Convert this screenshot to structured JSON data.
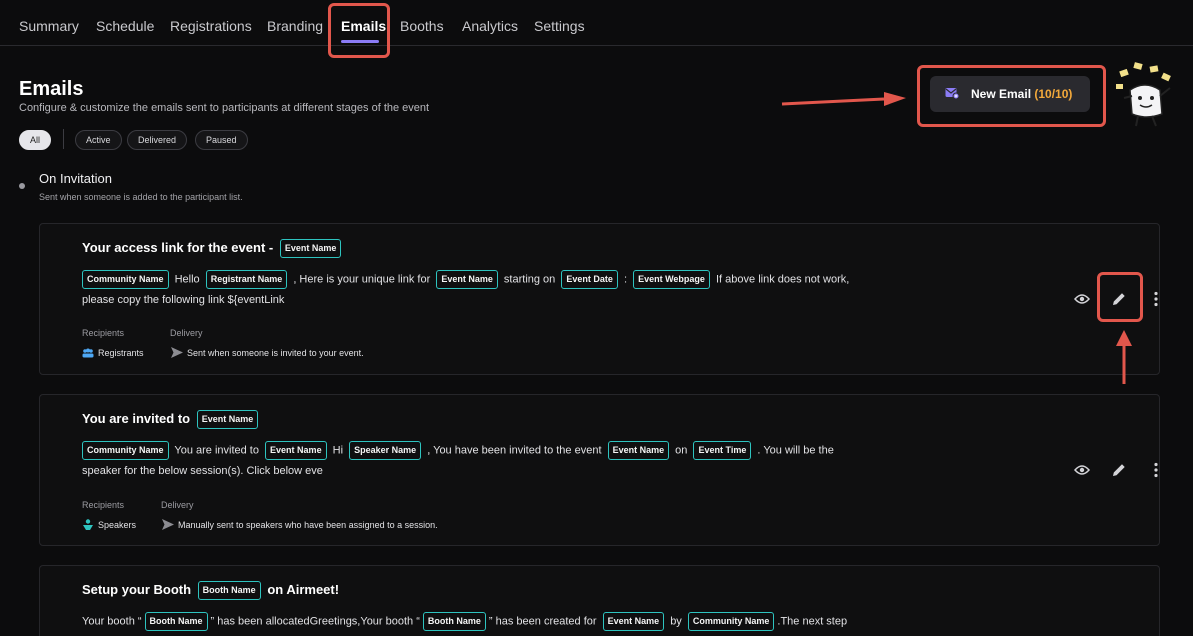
{
  "nav": {
    "tabs": [
      "Summary",
      "Schedule",
      "Registrations",
      "Branding",
      "Emails",
      "Booths",
      "Analytics",
      "Settings"
    ],
    "active": "Emails"
  },
  "header": {
    "title": "Emails",
    "subtitle": "Configure & customize the emails sent to participants at different stages of the event"
  },
  "filters": [
    "All",
    "Active",
    "Delivered",
    "Paused"
  ],
  "new_email": {
    "label": "New Email",
    "count": "(10/10)"
  },
  "section": {
    "title": "On Invitation",
    "subtitle": "Sent when someone is added to the participant list."
  },
  "meta_labels": {
    "recipients": "Recipients",
    "delivery": "Delivery"
  },
  "cards": [
    {
      "title_text": "Your access link for the event -",
      "title_tag": "Event Name",
      "line1": {
        "t1": "Community Name",
        "s1": "Hello",
        "t2": "Registrant Name",
        "s2": ", Here is your unique link for",
        "t3": "Event Name",
        "s3": "starting on",
        "t4": "Event Date",
        "s4": ":",
        "t5": "Event Webpage",
        "s5": "If above link does not work,"
      },
      "line2": "please copy the following link ${eventLink",
      "recipients": "Registrants",
      "delivery": "Sent when someone is invited to your event."
    },
    {
      "title_text": "You are invited to",
      "title_tag": "Event Name",
      "line1": {
        "t1": "Community Name",
        "s1": "You are invited to",
        "t2": "Event Name",
        "s2": "Hi",
        "t3": "Speaker Name",
        "s3": ", You have been invited to the event",
        "t4": "Event Name",
        "s4": "on",
        "t5": "Event Time",
        "s5": ". You will be the"
      },
      "line2": "speaker for the below session(s). Click below eve",
      "recipients": "Speakers",
      "delivery": "Manually sent to speakers who have been assigned to a session."
    },
    {
      "title_pre": "Setup your Booth",
      "title_tag": "Booth Name",
      "title_post": "on Airmeet!",
      "line1": {
        "s0": "Your booth “",
        "t1": "Booth Name",
        "s1": "” has been allocatedGreetings,Your booth “",
        "t2": "Booth Name",
        "s2": "” has been created for",
        "t3": "Event Name",
        "s3": "by",
        "t4": "Community Name",
        "s4": ".The next step"
      }
    }
  ],
  "colors": {
    "accent": "#8b7cf6",
    "tag_border": "#2ec4c0",
    "count": "#f3a93b",
    "annotation": "#e2574c"
  }
}
